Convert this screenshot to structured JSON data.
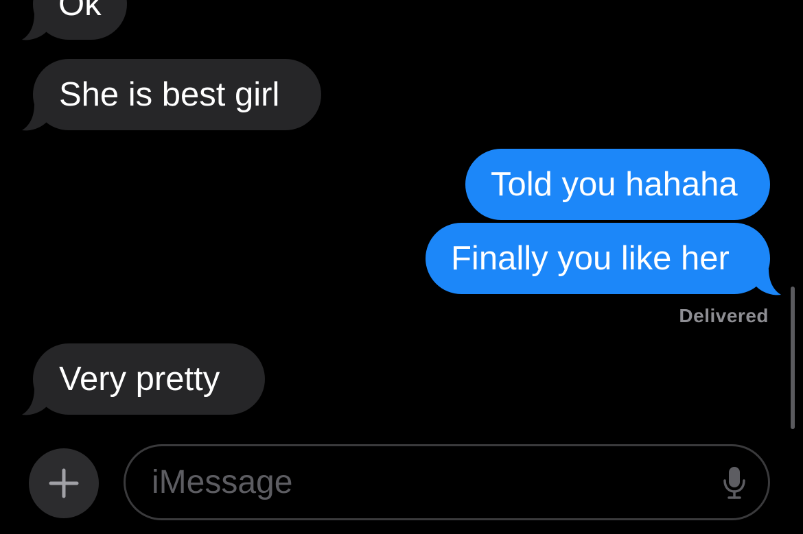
{
  "messages": [
    {
      "text": "Ok",
      "direction": "incoming"
    },
    {
      "text": "She is best girl",
      "direction": "incoming"
    },
    {
      "text": "Told you hahaha",
      "direction": "outgoing"
    },
    {
      "text": "Finally you like her",
      "direction": "outgoing"
    },
    {
      "text": "Very pretty",
      "direction": "incoming"
    }
  ],
  "status": {
    "delivered_label": "Delivered"
  },
  "composer": {
    "placeholder": "iMessage",
    "plus_icon": "plus-icon",
    "mic_icon": "microphone-icon"
  },
  "colors": {
    "background": "#000000",
    "incoming_bubble": "#262628",
    "outgoing_bubble": "#1c87f9",
    "text": "#ffffff",
    "secondary_text": "#8e8e93",
    "placeholder_text": "#5d5d62"
  }
}
